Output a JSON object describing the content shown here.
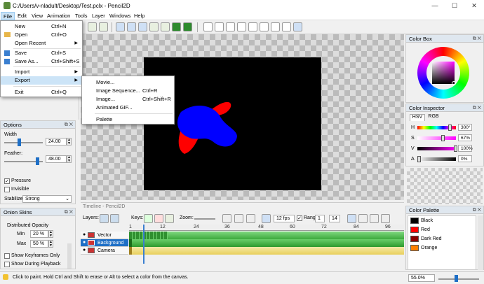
{
  "window": {
    "title": "C:/Users/v-nladult/Desktop/Test.pclx - Pencil2D",
    "minimize": "—",
    "maximize": "☐",
    "close": "✕"
  },
  "menubar": [
    "File",
    "Edit",
    "View",
    "Animation",
    "Tools",
    "Layer",
    "Windows",
    "Help"
  ],
  "file_menu": {
    "items": [
      {
        "label": "New",
        "shortcut": "Ctrl+N"
      },
      {
        "label": "Open",
        "shortcut": "Ctrl+O"
      },
      {
        "label": "Open Recent",
        "shortcut": "▶"
      },
      {
        "label": "Save",
        "shortcut": "Ctrl+S"
      },
      {
        "label": "Save As...",
        "shortcut": "Ctrl+Shift+S"
      },
      {
        "label": "Import",
        "shortcut": "▶"
      },
      {
        "label": "Export",
        "shortcut": "▶"
      },
      {
        "label": "Exit",
        "shortcut": "Ctrl+Q"
      }
    ]
  },
  "export_menu": {
    "items": [
      {
        "label": "Movie...",
        "shortcut": ""
      },
      {
        "label": "Image Sequence...",
        "shortcut": "Ctrl+R"
      },
      {
        "label": "Image...",
        "shortcut": "Ctrl+Shift+R"
      },
      {
        "label": "Animated GIF...",
        "shortcut": ""
      },
      {
        "label": "Palette",
        "shortcut": ""
      }
    ]
  },
  "options": {
    "title": "Options",
    "width_label": "Width",
    "width_value": "24.00",
    "feather_label": "Feather:",
    "feather_value": "48.00",
    "pressure": "Pressure",
    "invisible": "Invisible",
    "stabilizer_label": "Stabilizer",
    "stabilizer_value": "Strong"
  },
  "onion": {
    "title": "Onion Skins",
    "distributed": "Distributed Opacity",
    "min_label": "Min",
    "min_value": "20 %",
    "max_label": "Max",
    "max_value": "50 %",
    "show_keyframes": "Show Keyframes Only",
    "show_playback": "Show During Playback"
  },
  "colorbox": {
    "title": "Color Box"
  },
  "inspector": {
    "title": "Color Inspector",
    "tabs": [
      "HSV",
      "RGB"
    ],
    "rows": [
      {
        "label": "H",
        "value": "300°"
      },
      {
        "label": "S",
        "value": "67%"
      },
      {
        "label": "V",
        "value": "100%"
      },
      {
        "label": "A",
        "value": "0%"
      }
    ]
  },
  "palette": {
    "title": "Color Palette",
    "colors": [
      {
        "name": "Black",
        "hex": "#000000"
      },
      {
        "name": "Red",
        "hex": "#ff0000"
      },
      {
        "name": "Dark Red",
        "hex": "#8b0000"
      },
      {
        "name": "Orange",
        "hex": "#ff8000"
      }
    ]
  },
  "timeline": {
    "title": "Timeline - Pencil2D",
    "layers_label": "Layers:",
    "keys_label": "Keys:",
    "zoom_label": "Zoom:",
    "fps": "12 fps",
    "range_label": "Range",
    "range_start": "1",
    "range_end": "14",
    "ticks": [
      "1",
      "12",
      "24",
      "36",
      "48",
      "60",
      "72",
      "84",
      "96"
    ],
    "layers": [
      {
        "name": "Vector"
      },
      {
        "name": "Background"
      },
      {
        "name": "Camera"
      }
    ]
  },
  "status": {
    "text": "Click to paint. Hold Ctrl and Shift to erase or Alt to select a color from the canvas.",
    "zoom": "55.0%"
  }
}
